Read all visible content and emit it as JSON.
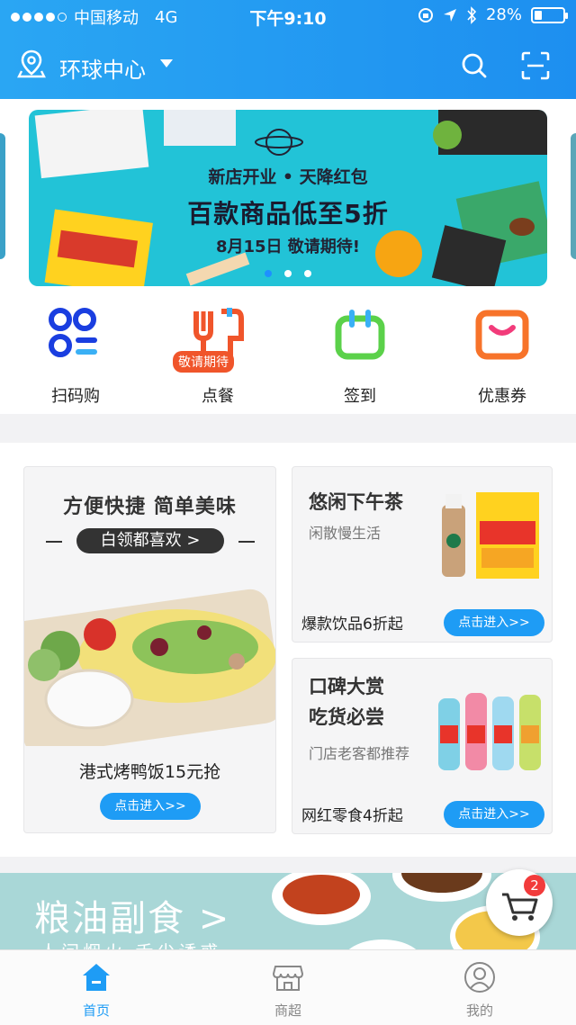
{
  "status_bar": {
    "carrier": "中国移动",
    "network": "4G",
    "time": "下午9:10",
    "battery": "28%",
    "battery_level": 0.28
  },
  "header": {
    "location": "环球中心",
    "icons": {
      "location": "location-pin-icon",
      "search": "search-icon",
      "scan": "scan-icon"
    }
  },
  "banner": {
    "line1": "新店开业 • 天降红包",
    "line2": "百款商品低至5折",
    "line3": "8月15日  敬请期待!",
    "pages": 3,
    "active_page": 1
  },
  "quick_entries": [
    {
      "label": "扫码购",
      "icon": "scan-buy-icon",
      "color": "#1a3ee0"
    },
    {
      "label": "点餐",
      "icon": "fork-knife-icon",
      "color": "#f0552b",
      "badge": "敬请期待"
    },
    {
      "label": "签到",
      "icon": "checkin-icon",
      "color": "#5bd14a"
    },
    {
      "label": "优惠券",
      "icon": "coupon-icon",
      "color": "#f7732a"
    }
  ],
  "promo_big": {
    "title": "方便快捷 简单美味",
    "pill": "白领都喜欢 >",
    "subtitle": "港式烤鸭饭15元抢",
    "button": "点击进入>>"
  },
  "promo_tea": {
    "title": "悠闲下午茶",
    "subtitle": "闲散慢生活",
    "bottom": "爆款饮品6折起",
    "button": "点击进入>>"
  },
  "promo_snack": {
    "title_line1": "口碑大赏",
    "title_line2": "吃货必尝",
    "subtitle": "门店老客都推荐",
    "bottom": "网红零食4折起",
    "button": "点击进入>>"
  },
  "strip": {
    "title": "粮油副食 >",
    "subtitle": "人间烟火 舌尖诱惑"
  },
  "cart": {
    "count": "2"
  },
  "tabbar": [
    {
      "label": "首页",
      "icon": "home-icon",
      "active": true
    },
    {
      "label": "商超",
      "icon": "store-icon",
      "active": false
    },
    {
      "label": "我的",
      "icon": "profile-icon",
      "active": false
    }
  ],
  "colors": {
    "accent": "#1e9cf5",
    "header": "#1d8ff0",
    "badge": "#f23b3b"
  }
}
